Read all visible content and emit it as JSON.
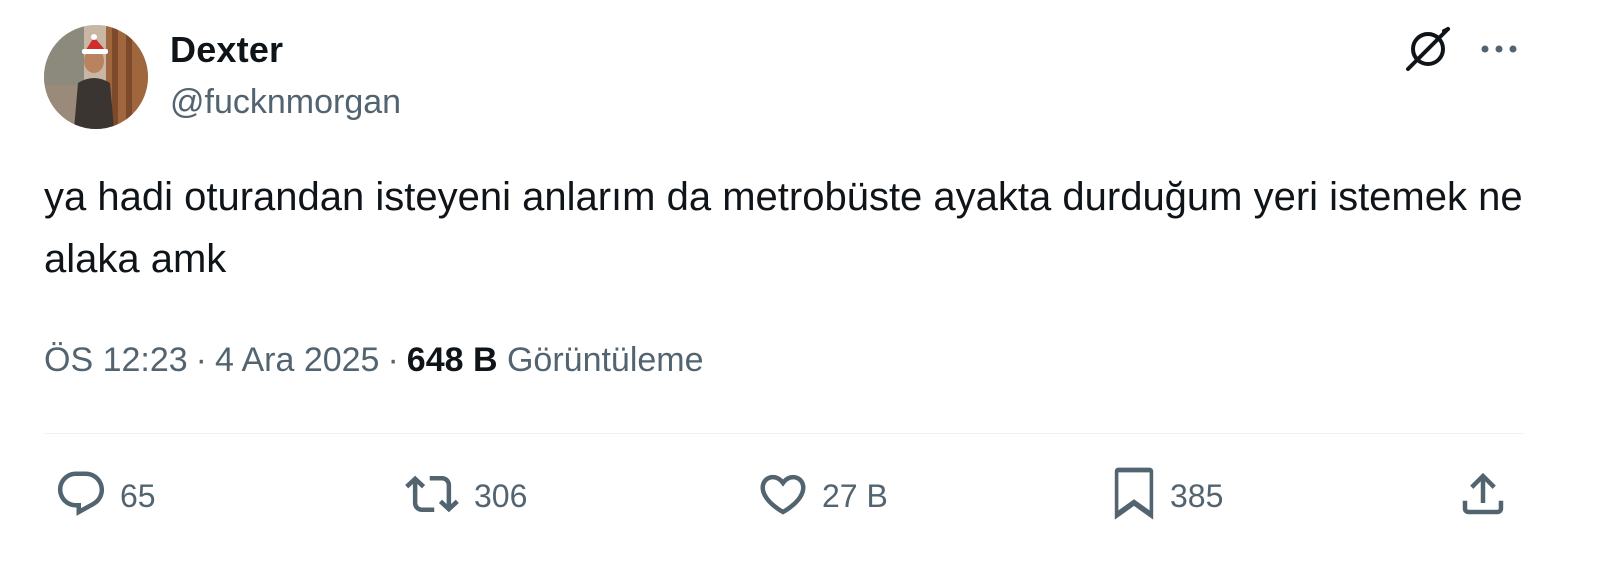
{
  "author": {
    "name": "Dexter",
    "handle": "@fucknmorgan"
  },
  "tweet": {
    "text": "ya hadi oturandan isteyeni anlarım da metrobüste ayakta durduğum yeri istemek ne alaka amk"
  },
  "meta": {
    "time": "ÖS 12:23",
    "date": "4 Ara 2025",
    "separator": "·",
    "views_count": "648 B",
    "views_label": "Görüntüleme"
  },
  "actions": {
    "replies": "65",
    "retweets": "306",
    "likes": "27 B",
    "bookmarks": "385"
  },
  "icons": {
    "grok": "grok-icon",
    "more": "more-icon",
    "reply": "reply-icon",
    "retweet": "retweet-icon",
    "like": "heart-icon",
    "bookmark": "bookmark-icon",
    "share": "share-icon"
  },
  "colors": {
    "text": "#0f1419",
    "secondary": "#536471",
    "divider": "#eff3f4"
  }
}
